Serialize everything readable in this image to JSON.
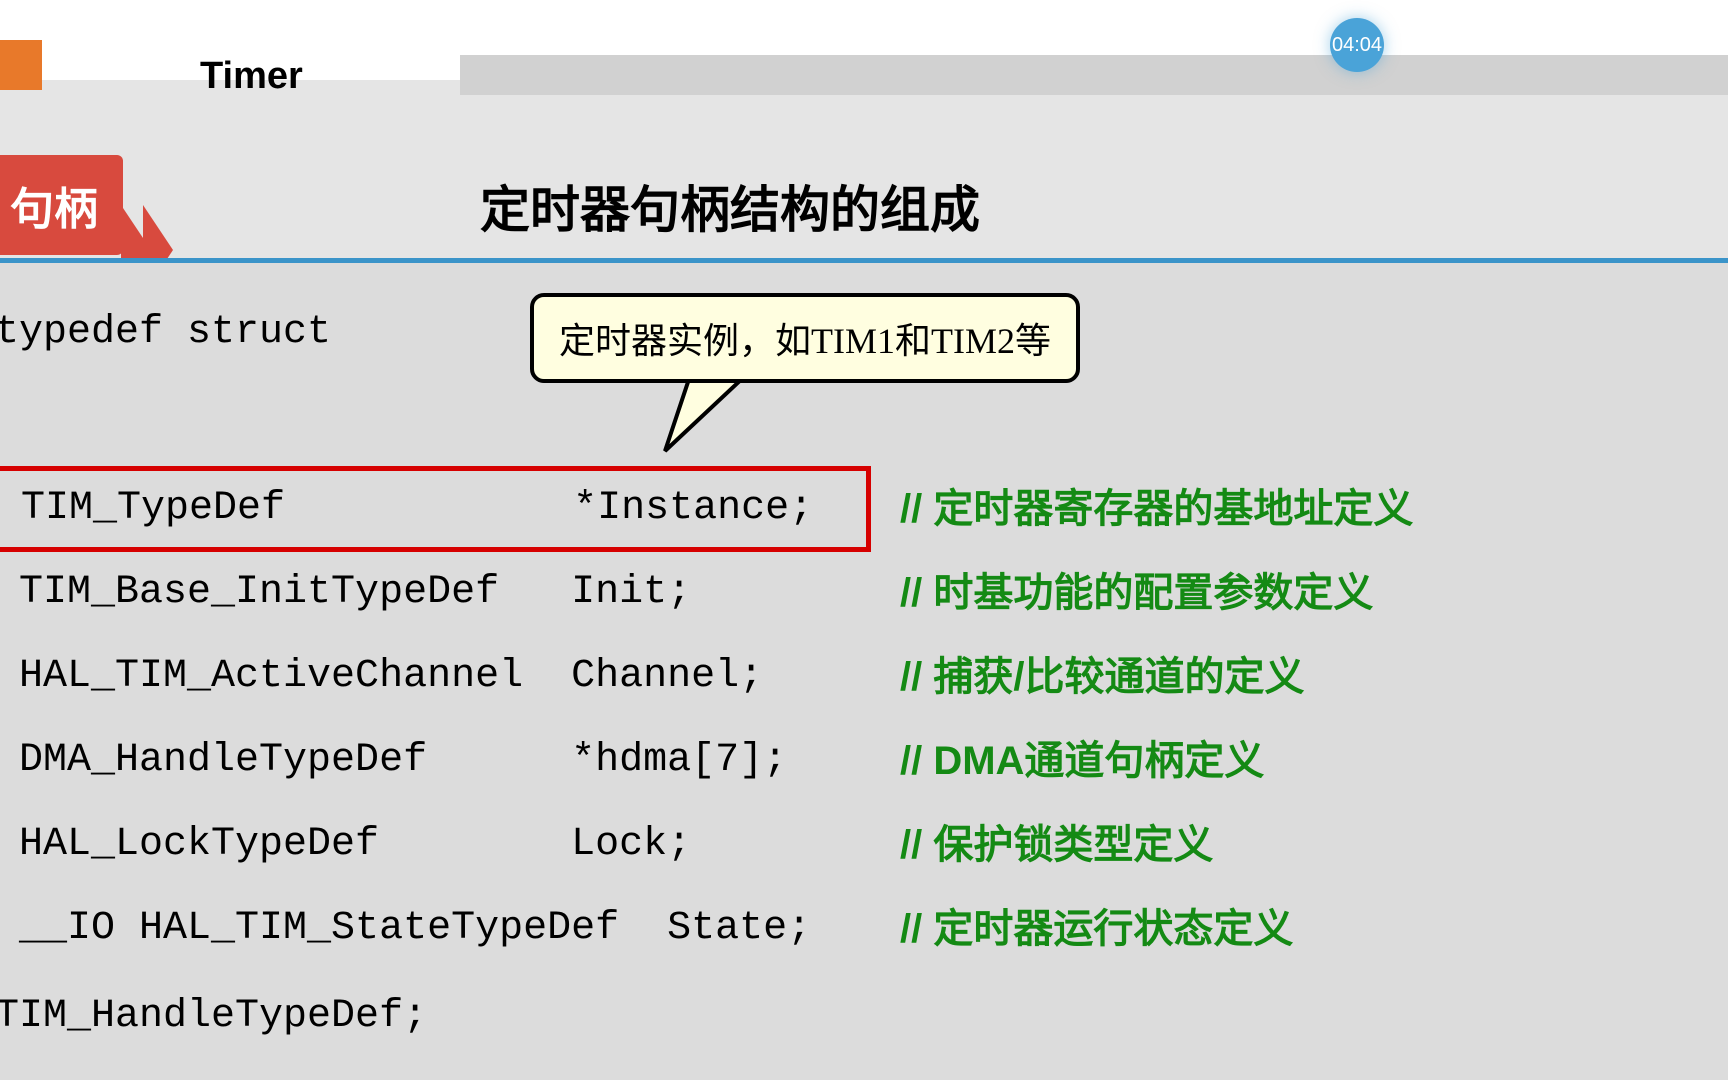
{
  "timestamp": "04:04",
  "header": {
    "timer_label": "Timer"
  },
  "section": {
    "label": "句柄",
    "title": "定时器句柄结构的组成"
  },
  "callout": {
    "text": "定时器实例，如TIM1和TIM2等"
  },
  "code": {
    "struct_open": "typedef struct",
    "brace_open": "",
    "members": [
      {
        "type": "TIM_TypeDef",
        "name": "*Instance;",
        "comment": "// 定时器寄存器的基地址定义",
        "highlighted": true
      },
      {
        "type": "TIM_Base_InitTypeDef",
        "name": "Init;",
        "comment": "// 时基功能的配置参数定义",
        "highlighted": false
      },
      {
        "type": "HAL_TIM_ActiveChannel",
        "name": "Channel;",
        "comment": "// 捕获/比较通道的定义",
        "highlighted": false
      },
      {
        "type": "DMA_HandleTypeDef",
        "name": "*hdma[7];",
        "comment": "// DMA通道句柄定义",
        "highlighted": false
      },
      {
        "type": "HAL_LockTypeDef",
        "name": "Lock;",
        "comment": "// 保护锁类型定义",
        "highlighted": false
      },
      {
        "type": "__IO HAL_TIM_StateTypeDef",
        "name": "State;",
        "comment": "// 定时器运行状态定义",
        "highlighted": false
      }
    ],
    "struct_close": "TIM_HandleTypeDef;"
  }
}
